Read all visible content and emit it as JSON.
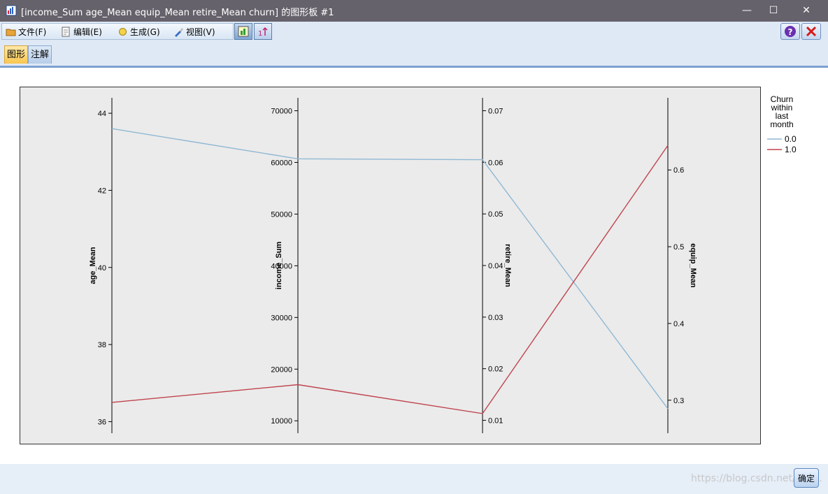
{
  "window": {
    "title": "[income_Sum age_Mean equip_Mean retire_Mean churn] 的图形板 #1",
    "minimize": "—",
    "maximize": "☐",
    "close": "✕"
  },
  "menu": {
    "file": "文件(F)",
    "edit": "编辑(E)",
    "generate": "生成(G)",
    "view": "视图(V)"
  },
  "tabs": {
    "graph": "图形",
    "annotation": "注解"
  },
  "footer": {
    "ok": "确定",
    "watermark": "https://blog.csdn.net/qq_..."
  },
  "colors": {
    "series0": "#8fb8d4",
    "series1": "#c0444e"
  },
  "chart_data": {
    "type": "parallel_coordinates",
    "axes": [
      {
        "name": "age_Mean",
        "range": [
          35.7,
          44.4
        ],
        "ticks": [
          36,
          38,
          40,
          42,
          44
        ],
        "tick_side": "left"
      },
      {
        "name": "income_Sum",
        "range": [
          7600,
          72500
        ],
        "ticks": [
          10000,
          20000,
          30000,
          40000,
          50000,
          60000,
          70000
        ],
        "tick_side": "left"
      },
      {
        "name": "retire_Mean",
        "range": [
          0.0075,
          0.0725
        ],
        "ticks": [
          "0.01",
          "0.02",
          "0.03",
          "0.04",
          "0.05",
          "0.06",
          "0.07"
        ],
        "tick_side": "right"
      },
      {
        "name": "equip_Mean",
        "range": [
          0.257,
          0.694
        ],
        "ticks": [
          "0.3",
          "0.4",
          "0.5",
          "0.6"
        ],
        "tick_side": "right"
      }
    ],
    "legend": {
      "title": [
        "Churn",
        "within",
        "last",
        "month"
      ],
      "position": "right"
    },
    "series": [
      {
        "name": "0.0",
        "values": [
          43.6,
          60700,
          0.0605,
          0.289
        ]
      },
      {
        "name": "1.0",
        "values": [
          36.5,
          17000,
          0.0113,
          0.632
        ]
      }
    ]
  }
}
